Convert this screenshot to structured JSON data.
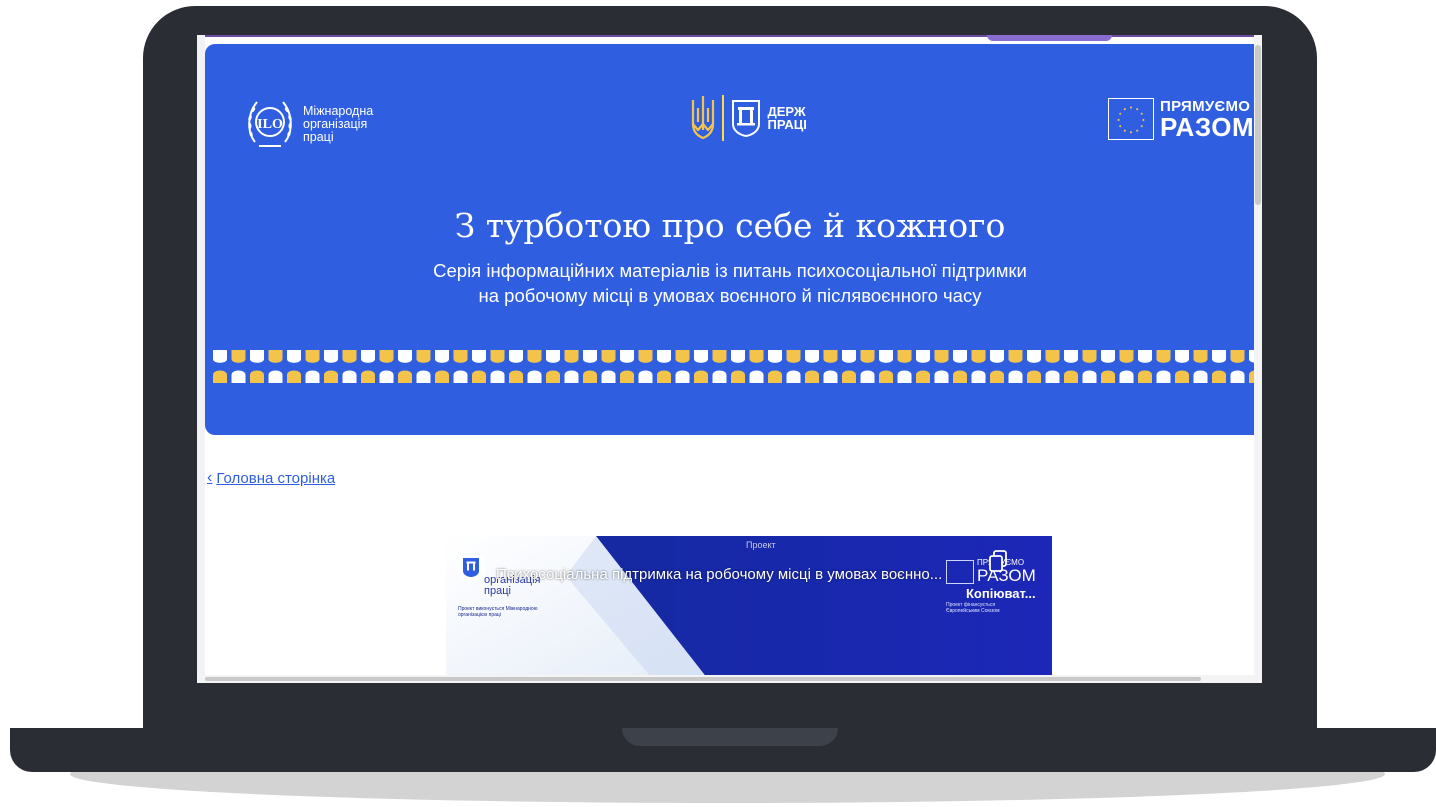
{
  "banner": {
    "ilo_name_lines": [
      "Міжнародна",
      "організація",
      "праці"
    ],
    "derzh_lines": [
      "ДЕРЖ",
      "ПРАЦІ"
    ],
    "eu_line1": "ПРЯМУЄМО",
    "eu_line2": "РАЗОМ",
    "title": "З турботою про себе й кожного",
    "subtitle_line1": "Серія інформаційних матеріалів із питань психосоціальної підтримки",
    "subtitle_line2": "на робочому місці в умовах воєнного й післявоєнного часу",
    "pattern_colors": [
      "#ffffff",
      "#f4c34a"
    ]
  },
  "nav": {
    "back_icon": "chevron-left-icon",
    "back_label": "Головна сторінка"
  },
  "video": {
    "title": "Психосоціальна підтримка на робочому місці в умовах воєнно...",
    "copy_label": "Копіюват...",
    "overlay_ilo_lines": [
      "організація",
      "праці"
    ],
    "overlay_project": "Проект",
    "overlay_desc": "Проект виконується Міжнародною організацією праці",
    "overlay_eu_line1": "ПРЯМУЄМО",
    "overlay_eu_line2": "РАЗОМ",
    "overlay_eu_note": "Проект фінансується Європейським Союзом"
  },
  "colors": {
    "banner_blue": "#2f5fe0",
    "accent_yellow": "#f4c34a",
    "laptop_frame": "#2a2d34",
    "link_blue": "#2f5fe0"
  }
}
